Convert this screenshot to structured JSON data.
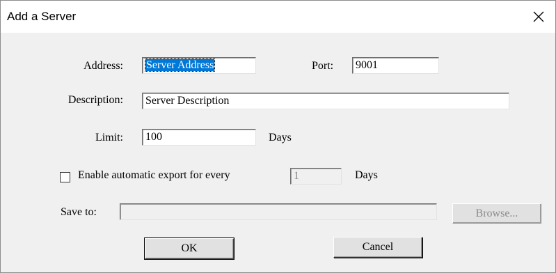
{
  "window": {
    "title": "Add a Server",
    "close_glyph": "✕"
  },
  "form": {
    "address_label": "Address:",
    "address_value": "Server Address",
    "port_label": "Port:",
    "port_value": "9001",
    "description_label": "Description:",
    "description_value": "Server Description",
    "limit_label": "Limit:",
    "limit_value": "100",
    "limit_unit": "Days",
    "auto_export_label": "Enable automatic export for every",
    "auto_export_checked": false,
    "auto_export_value": "1",
    "auto_export_unit": "Days",
    "save_to_label": "Save to:",
    "save_to_value": ""
  },
  "buttons": {
    "browse_label": "Browse...",
    "ok_label": "OK",
    "cancel_label": "Cancel"
  },
  "icons": {
    "close": "close-icon"
  }
}
